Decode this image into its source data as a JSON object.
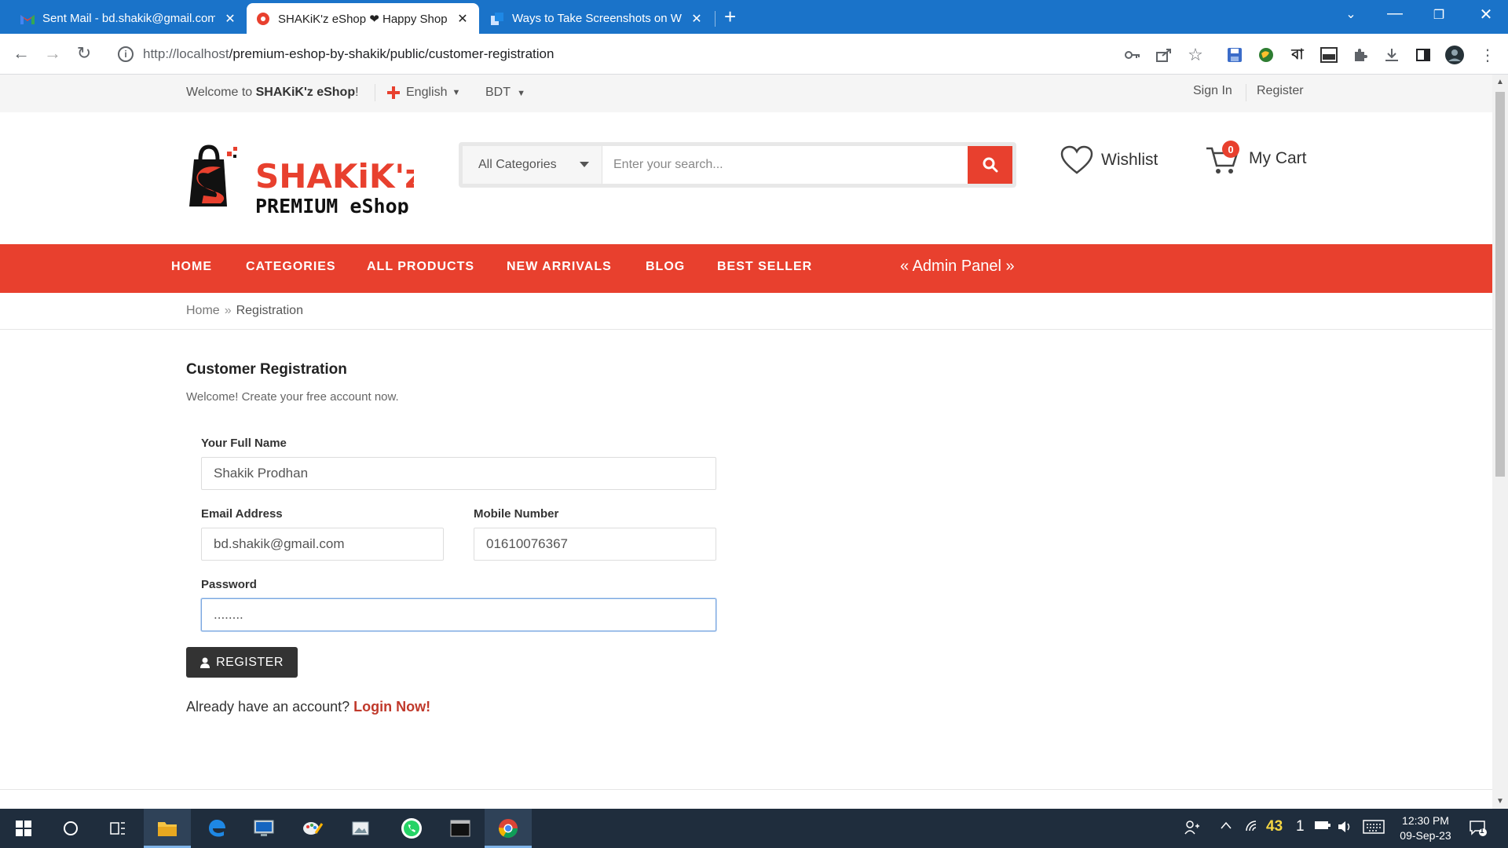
{
  "browser": {
    "tabs": [
      {
        "label": "Sent Mail - bd.shakik@gmail.com",
        "close": "✕"
      },
      {
        "label": "SHAKiK'z eShop ❤ Happy Shopping",
        "close": "✕"
      },
      {
        "label": "Ways to Take Screenshots on Windows",
        "close": "✕"
      }
    ],
    "new_tab": "+",
    "url_host": "http://localhost",
    "url_path": "/premium-eshop-by-shakik/public/customer-registration",
    "ext_bangla": "বা"
  },
  "site": {
    "topbar": {
      "welcome_prefix": "Welcome to ",
      "welcome_brand": "SHAKiK'z eShop",
      "welcome_suffix": "!",
      "language": "English",
      "currency": "BDT",
      "sign_in": "Sign In",
      "register": "Register"
    },
    "logo": {
      "line1": "SHAKiK'z",
      "line2": "PREMIUM eShop"
    },
    "search": {
      "category": "All Categories",
      "placeholder": "Enter your search..."
    },
    "wishlist_label": "Wishlist",
    "cart": {
      "label": "My Cart",
      "count": "0"
    },
    "nav": [
      "HOME",
      "CATEGORIES",
      "ALL PRODUCTS",
      "NEW ARRIVALS",
      "BLOG",
      "BEST SELLER"
    ],
    "admin_panel": "« Admin Panel »",
    "breadcrumb": {
      "home": "Home",
      "sep": "»",
      "current": "Registration"
    },
    "form": {
      "title": "Customer Registration",
      "subtitle": "Welcome! Create your free account now.",
      "name_label": "Your Full Name",
      "name_value": "Shakik Prodhan",
      "email_label": "Email Address",
      "email_value": "bd.shakik@gmail.com",
      "mobile_label": "Mobile Number",
      "mobile_value": "01610076367",
      "password_label": "Password",
      "password_value": "........",
      "register_button": "REGISTER",
      "login_prompt": "Already have an account? ",
      "login_link": "Login Now!"
    }
  },
  "taskbar": {
    "temperature": "43",
    "notif_count": "1",
    "time": "12:30 PM",
    "date": "09-Sep-23",
    "action_badge": "1"
  },
  "colors": {
    "accent": "#e8402e",
    "chrome": "#1a73c9",
    "taskbar": "#1f2d3d",
    "button_dark": "#333333",
    "link": "#c0392b"
  }
}
